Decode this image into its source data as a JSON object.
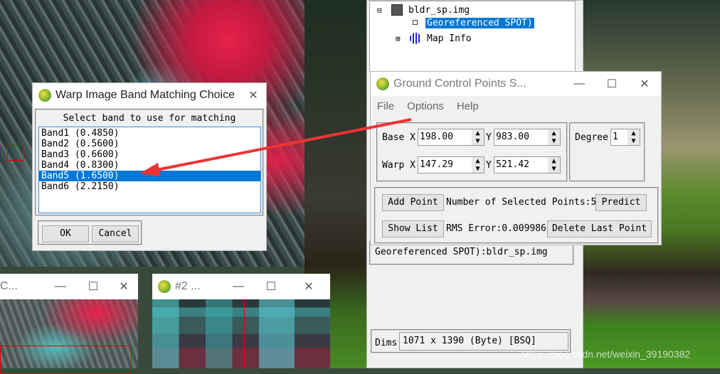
{
  "tree": {
    "file": "bldr_sp.img",
    "child": "Georeferenced SPOT)",
    "map_info": "Map Info"
  },
  "file_info": {
    "desc": "Georeferenced SPOT):bldr_sp.img",
    "dims_label": "Dims",
    "dims": "1071 x 1390 (Byte) [BSQ]"
  },
  "band_dialog": {
    "title": "Warp Image Band Matching Choice",
    "prompt": "Select band to use for matching",
    "bands": [
      "Band1 (0.4850)",
      "Band2 (0.5600)",
      "Band3 (0.6600)",
      "Band4 (0.8300)",
      "Band5 (1.6500)",
      "Band6 (2.2150)"
    ],
    "selected_index": 4,
    "ok": "OK",
    "cancel": "Cancel"
  },
  "gcp": {
    "title": "Ground Control Points S...",
    "menu": [
      "File",
      "Options",
      "Help"
    ],
    "base_label": "Base X",
    "base_x": "198.00",
    "base_y": "983.00",
    "y_label": "Y",
    "warp_label": "Warp X",
    "warp_x": "147.29",
    "warp_y": "521.42",
    "degree_label": "Degree",
    "degree": "1",
    "add_point": "Add Point",
    "selected_points": "Number of Selected Points:5",
    "predict": "Predict",
    "show_list": "Show List",
    "rms": "RMS Error:0.009986",
    "delete_last": "Delete Last Point"
  },
  "win1": {
    "title": "C..."
  },
  "win2": {
    "title": "#2 ..."
  },
  "watermark": "https://blog.csdn.net/weixin_39190382",
  "colors": {
    "selection": "#0078d7",
    "arrow": "#ee3333"
  }
}
